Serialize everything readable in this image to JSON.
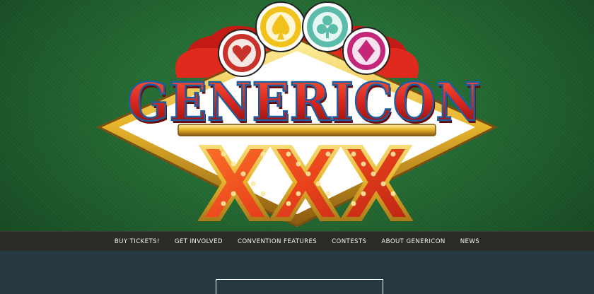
{
  "site": {
    "logo_alt": "Genericon XXX",
    "logo_text": "GENERICON",
    "logo_numeral": "XXX",
    "chip_suits": [
      "heart",
      "spade",
      "club",
      "diamond"
    ]
  },
  "nav": {
    "items": [
      {
        "label": "BUY TICKETS!"
      },
      {
        "label": "GET INVOLVED"
      },
      {
        "label": "CONVENTION FEATURES"
      },
      {
        "label": "CONTESTS"
      },
      {
        "label": "ABOUT GENERICON"
      },
      {
        "label": "NEWS"
      }
    ]
  },
  "colors": {
    "felt": "#246b33",
    "nav_bg": "#2b2b28",
    "content_bg": "#263840",
    "logo_red": "#d8261f",
    "logo_gold": "#e8b52c",
    "chip_red": "#c8322a",
    "chip_yellow": "#f2c21c",
    "chip_teal": "#5cbcaa",
    "chip_magenta": "#c4267a"
  }
}
